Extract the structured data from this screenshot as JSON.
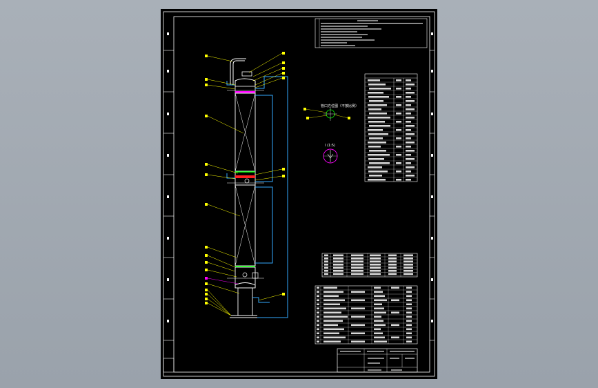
{
  "viewer": {
    "background_color": "#a3aab2",
    "sheet_color": "#000000"
  },
  "drawing": {
    "description_texts": {
      "detail_a": "管口方位图（不按比例）",
      "detail_b": "I (1:5)"
    },
    "colors": {
      "frame": "#ffffff",
      "column": "#ffffff",
      "leader": "#ffff00",
      "piping": "#33aaff",
      "packing": "#ffffff",
      "tray_green": "#00ff00",
      "tray_red": "#ff2020",
      "tray_magenta": "#ff00ff"
    },
    "title_block": {
      "cells": [
        "",
        "",
        "",
        "",
        "",
        ""
      ]
    }
  }
}
